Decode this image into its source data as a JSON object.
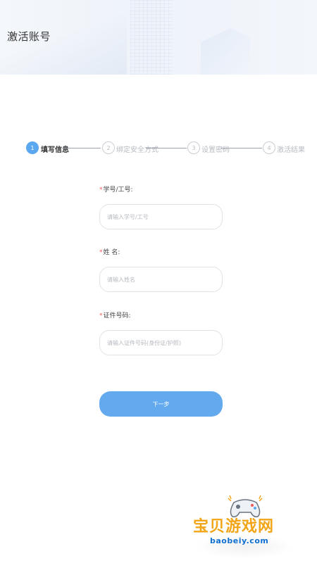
{
  "header": {
    "title": "激活账号"
  },
  "stepper": {
    "steps": [
      {
        "number": "1",
        "label": "填写信息",
        "state": "active"
      },
      {
        "number": "2",
        "label": "绑定安全方式",
        "state": "inactive"
      },
      {
        "number": "3",
        "label": "设置密码",
        "state": "inactive"
      },
      {
        "number": "4",
        "label": "激活结果",
        "state": "inactive"
      }
    ]
  },
  "form": {
    "required_mark": "*",
    "fields": [
      {
        "label": "学号/工号:",
        "placeholder": "请输入学号/工号",
        "value": ""
      },
      {
        "label": "姓 名:",
        "placeholder": "请输入姓名",
        "value": ""
      },
      {
        "label": "证件号码:",
        "placeholder": "请输入证件号码(身份证/护照)",
        "value": ""
      }
    ],
    "next_button_label": "下一步"
  },
  "watermark": {
    "title": "宝贝游戏网",
    "url": "baobeiy.com"
  },
  "colors": {
    "accent": "#5aa8f0",
    "button": "#62a9ee",
    "required": "#f05a5a",
    "watermark_title": "#f2a516",
    "watermark_url": "#0f6fd0"
  }
}
